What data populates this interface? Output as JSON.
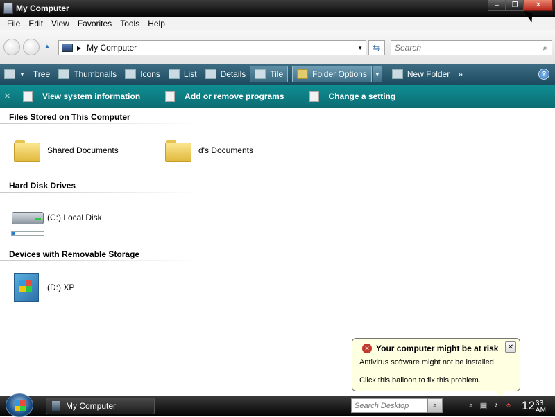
{
  "window": {
    "title": "My Computer",
    "buttons": {
      "minimize": "–",
      "restore": "❐",
      "close": "✕"
    }
  },
  "menu": [
    "File",
    "Edit",
    "View",
    "Favorites",
    "Tools",
    "Help"
  ],
  "address": {
    "path": "My Computer",
    "search_placeholder": "Search"
  },
  "toolbar": {
    "items": [
      {
        "label": "Tree",
        "icon": "tree-icon"
      },
      {
        "label": "Thumbnails",
        "icon": "thumbnails-icon"
      },
      {
        "label": "Icons",
        "icon": "icons-view-icon"
      },
      {
        "label": "List",
        "icon": "list-view-icon"
      },
      {
        "label": "Details",
        "icon": "details-view-icon"
      },
      {
        "label": "Tile",
        "icon": "tile-view-icon"
      }
    ],
    "folder_options": "Folder Options",
    "new_folder": "New Folder",
    "more": "»",
    "help": "?"
  },
  "tasks": [
    {
      "label": "View system information",
      "icon": "system-info-icon"
    },
    {
      "label": "Add or remove programs",
      "icon": "programs-icon"
    },
    {
      "label": "Change a setting",
      "icon": "settings-icon"
    }
  ],
  "groups": {
    "files": {
      "title": "Files Stored on This Computer",
      "items": [
        "Shared Documents",
        "d's Documents"
      ]
    },
    "drives": {
      "title": "Hard Disk Drives",
      "items": [
        "(C:) Local Disk"
      ],
      "c_used_fraction": 0.08
    },
    "removable": {
      "title": "Devices with Removable Storage",
      "items": [
        "(D:) XP"
      ]
    }
  },
  "balloon": {
    "title": "Your computer might be at risk",
    "line1": "Antivirus software might not be installed",
    "line2": "Click this balloon to fix this problem."
  },
  "taskbar": {
    "window_button": "My Computer",
    "search_placeholder": "Search Desktop",
    "clock_hour": "12",
    "clock_minute": "33",
    "clock_ampm": "AM"
  }
}
